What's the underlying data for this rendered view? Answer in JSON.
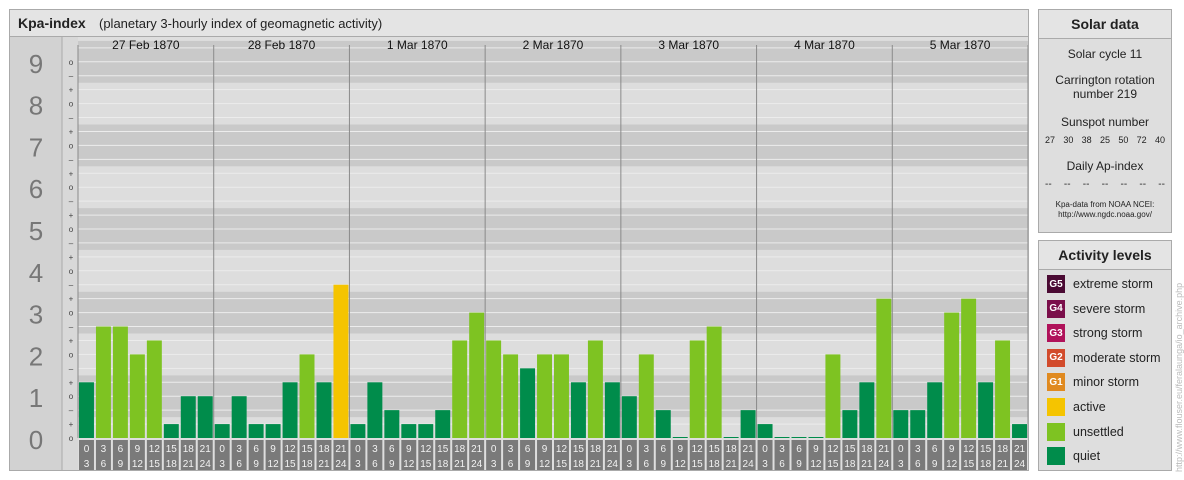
{
  "header": {
    "title": "Kpa-index",
    "subtitle": "(planetary 3-hourly index of geomagnetic activity)"
  },
  "chart_data": {
    "type": "bar",
    "ylim": [
      0,
      9
    ],
    "yticks": [
      "0",
      "1",
      "2",
      "3",
      "4",
      "5",
      "6",
      "7",
      "8",
      "9"
    ],
    "subticks": [
      "o",
      "+",
      "–"
    ],
    "days": [
      "27 Feb 1870",
      "28 Feb 1870",
      "1 Mar 1870",
      "2 Mar 1870",
      "3 Mar 1870",
      "4 Mar 1870",
      "5 Mar 1870"
    ],
    "interval_starts": [
      "0",
      "3",
      "6",
      "9",
      "12",
      "15",
      "18",
      "21"
    ],
    "interval_ends": [
      "3",
      "6",
      "9",
      "12",
      "15",
      "18",
      "21",
      "24"
    ],
    "values": [
      1.333,
      2.667,
      2.667,
      2,
      2.333,
      0.333,
      1,
      1,
      0.333,
      1,
      0.333,
      0.333,
      1.333,
      2,
      1.333,
      3.667,
      0.333,
      1.333,
      0.667,
      0.333,
      0.333,
      0.667,
      2.333,
      3,
      2.333,
      2,
      1.667,
      2,
      2,
      1.333,
      2.333,
      1.333,
      1,
      2,
      0.667,
      0,
      2.333,
      2.667,
      0,
      0.667,
      0.333,
      0,
      0,
      0,
      2,
      0.667,
      1.333,
      3.333,
      0.667,
      0.667,
      1.333,
      3,
      3.333,
      1.333,
      2.333,
      0.333
    ],
    "levels": [
      {
        "name": "quiet",
        "max": 2,
        "color": "#008c4b"
      },
      {
        "name": "unsettled",
        "max": 3.5,
        "color": "#7ec322"
      },
      {
        "name": "active",
        "max": 4.5,
        "color": "#f5c400"
      },
      {
        "name": "minor storm",
        "max": 5.5,
        "color": "#e08a20"
      },
      {
        "name": "moderate storm",
        "max": 6.5,
        "color": "#d24b2c"
      },
      {
        "name": "strong storm",
        "max": 7.5,
        "color": "#b0125a"
      },
      {
        "name": "severe storm",
        "max": 8.5,
        "color": "#7b0f4b"
      },
      {
        "name": "extreme storm",
        "max": 9.5,
        "color": "#4a0a33"
      }
    ]
  },
  "solar": {
    "title": "Solar data",
    "cycle": "Solar cycle 11",
    "rotation_line1": "Carrington rotation",
    "rotation_line2": "number 219",
    "sunspot_title": "Sunspot number",
    "sunspots": [
      "27",
      "30",
      "38",
      "25",
      "50",
      "72",
      "40"
    ],
    "ap_title": "Daily Ap-index",
    "ap_values": [
      "--",
      "--",
      "--",
      "--",
      "--",
      "--",
      "--"
    ],
    "source_line1": "Kpa-data from NOAA NCEI:",
    "source_line2": "http://www.ngdc.noaa.gov/"
  },
  "activity": {
    "title": "Activity levels",
    "items": [
      {
        "badge": "G5",
        "label": "extreme storm",
        "color": "#4a0a33"
      },
      {
        "badge": "G4",
        "label": "severe storm",
        "color": "#7b0f4b"
      },
      {
        "badge": "G3",
        "label": "strong storm",
        "color": "#b0125a"
      },
      {
        "badge": "G2",
        "label": "moderate storm",
        "color": "#d24b2c"
      },
      {
        "badge": "G1",
        "label": "minor storm",
        "color": "#e08a20"
      },
      {
        "badge": "",
        "label": "active",
        "color": "#f5c400"
      },
      {
        "badge": "",
        "label": "unsettled",
        "color": "#7ec322"
      },
      {
        "badge": "",
        "label": "quiet",
        "color": "#008c4b"
      }
    ]
  },
  "watermark": "http://www.flouser.eu/feralaunga/io_archive.php"
}
